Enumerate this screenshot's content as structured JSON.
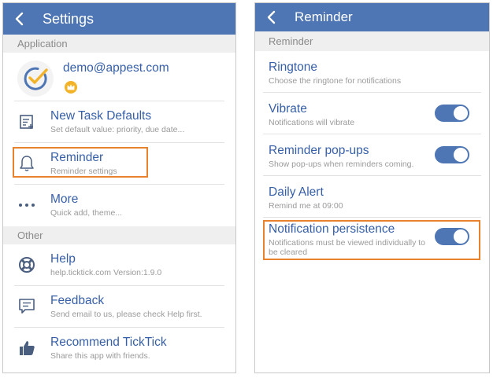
{
  "left": {
    "header": {
      "title": "Settings"
    },
    "sections": {
      "application": "Application",
      "other": "Other"
    },
    "account": {
      "email": "demo@appest.com"
    },
    "items": {
      "new_task_defaults": {
        "label": "New Task Defaults",
        "sub": "Set default value: priority, due date..."
      },
      "reminder": {
        "label": "Reminder",
        "sub": "Reminder settings"
      },
      "more": {
        "label": "More",
        "sub": "Quick add, theme..."
      },
      "help": {
        "label": "Help",
        "sub": "help.ticktick.com  Version:1.9.0"
      },
      "feedback": {
        "label": "Feedback",
        "sub": "Send email to us, please check Help first."
      },
      "recommend": {
        "label": "Recommend TickTick",
        "sub": "Share this app with friends."
      }
    }
  },
  "right": {
    "header": {
      "title": "Reminder"
    },
    "section": "Reminder",
    "items": {
      "ringtone": {
        "label": "Ringtone",
        "sub": "Choose the ringtone for notifications"
      },
      "vibrate": {
        "label": "Vibrate",
        "sub": "Notifications will vibrate",
        "on": true
      },
      "popups": {
        "label": "Reminder pop-ups",
        "sub": "Show pop-ups when reminders coming.",
        "on": true
      },
      "daily_alert": {
        "label": "Daily Alert",
        "sub": "Remind me at 09:00"
      },
      "persistence": {
        "label": "Notification persistence",
        "sub": "Notifications must be viewed individually to be cleared",
        "on": true
      }
    }
  },
  "colors": {
    "accent": "#4f76b4",
    "link_text": "#365fa8",
    "highlight": "#e8822e",
    "crown": "#f3b328"
  }
}
